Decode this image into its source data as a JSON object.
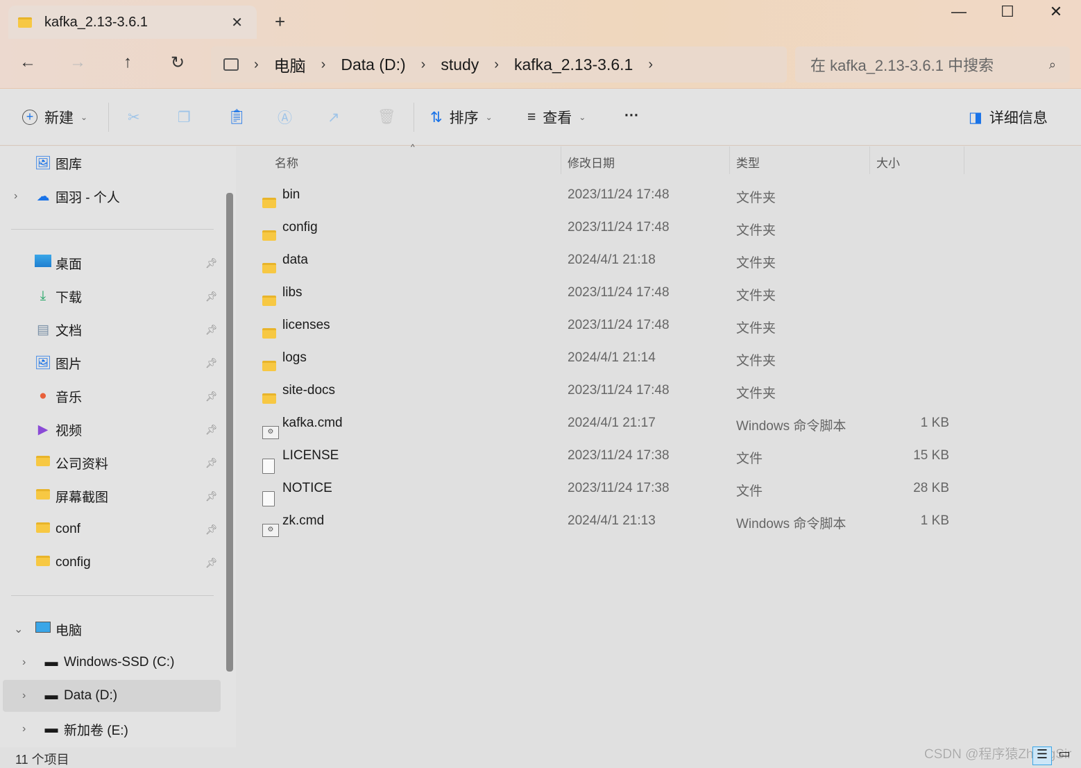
{
  "window": {
    "tab_title": "kafka_2.13-3.6.1",
    "close_tab": "✕",
    "new_tab": "+",
    "minimize": "—",
    "maximize": "☐",
    "close": "✕"
  },
  "nav": {
    "back": "←",
    "forward": "→",
    "up": "↑",
    "refresh": "↻"
  },
  "breadcrumb": [
    "电脑",
    "Data (D:)",
    "study",
    "kafka_2.13-3.6.1"
  ],
  "search": {
    "placeholder": "在 kafka_2.13-3.6.1 中搜索"
  },
  "toolbar": {
    "new": "新建",
    "sort": "排序",
    "view": "查看",
    "more": "···",
    "details": "详细信息"
  },
  "sidebar": {
    "top": [
      {
        "label": "图库"
      },
      {
        "label": "国羽 - 个人"
      }
    ],
    "quick": [
      {
        "label": "桌面"
      },
      {
        "label": "下载"
      },
      {
        "label": "文档"
      },
      {
        "label": "图片"
      },
      {
        "label": "音乐"
      },
      {
        "label": "视频"
      },
      {
        "label": "公司资料"
      },
      {
        "label": "屏幕截图"
      },
      {
        "label": "conf"
      },
      {
        "label": "config"
      }
    ],
    "pc": {
      "label": "电脑"
    },
    "drives": [
      {
        "label": "Windows-SSD (C:)"
      },
      {
        "label": "Data (D:)"
      },
      {
        "label": "新加卷 (E:)"
      }
    ]
  },
  "columns": {
    "name": "名称",
    "date": "修改日期",
    "type": "类型",
    "size": "大小"
  },
  "files": [
    {
      "name": "bin",
      "date": "2023/11/24 17:48",
      "type": "文件夹",
      "size": "",
      "kind": "folder"
    },
    {
      "name": "config",
      "date": "2023/11/24 17:48",
      "type": "文件夹",
      "size": "",
      "kind": "folder"
    },
    {
      "name": "data",
      "date": "2024/4/1 21:18",
      "type": "文件夹",
      "size": "",
      "kind": "folder"
    },
    {
      "name": "libs",
      "date": "2023/11/24 17:48",
      "type": "文件夹",
      "size": "",
      "kind": "folder"
    },
    {
      "name": "licenses",
      "date": "2023/11/24 17:48",
      "type": "文件夹",
      "size": "",
      "kind": "folder"
    },
    {
      "name": "logs",
      "date": "2024/4/1 21:14",
      "type": "文件夹",
      "size": "",
      "kind": "folder"
    },
    {
      "name": "site-docs",
      "date": "2023/11/24 17:48",
      "type": "文件夹",
      "size": "",
      "kind": "folder"
    },
    {
      "name": "kafka.cmd",
      "date": "2024/4/1 21:17",
      "type": "Windows 命令脚本",
      "size": "1 KB",
      "kind": "cmd"
    },
    {
      "name": "LICENSE",
      "date": "2023/11/24 17:38",
      "type": "文件",
      "size": "15 KB",
      "kind": "doc"
    },
    {
      "name": "NOTICE",
      "date": "2023/11/24 17:38",
      "type": "文件",
      "size": "28 KB",
      "kind": "doc"
    },
    {
      "name": "zk.cmd",
      "date": "2024/4/1 21:13",
      "type": "Windows 命令脚本",
      "size": "1 KB",
      "kind": "cmd"
    }
  ],
  "status": {
    "count": "11 个项目"
  },
  "watermark": "CSDN @程序猿ZhangSir"
}
